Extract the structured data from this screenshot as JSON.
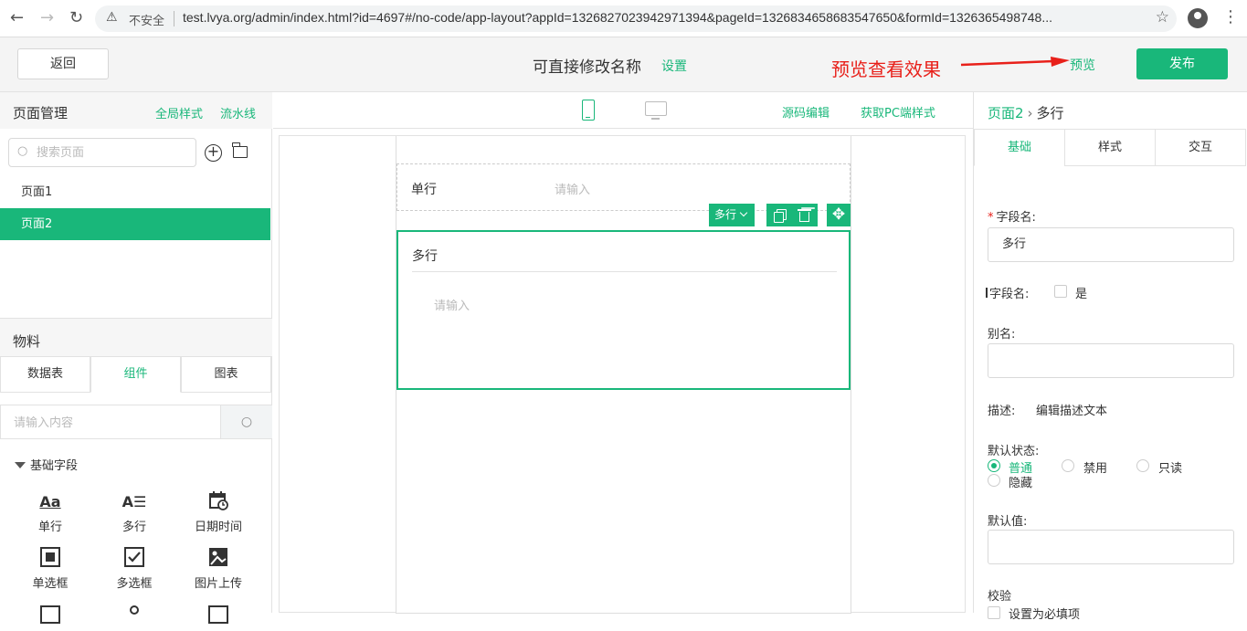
{
  "browser": {
    "insecure_label": "不安全",
    "url": "test.lvya.org/admin/index.html?id=4697#/no-code/app-layout?appId=1326827023942971394&pageId=1326834658683547650&formId=1326365498748..."
  },
  "toolbar": {
    "back_label": "返回",
    "app_name": "可直接修改名称",
    "settings_label": "设置",
    "annotation": "预览查看效果",
    "preview_label": "预览",
    "publish_label": "发布",
    "accent_color": "#19b77a",
    "annotation_color": "#e8201a"
  },
  "left": {
    "title": "页面管理",
    "global_style": "全局样式",
    "pipeline": "流水线",
    "search_placeholder": "搜索页面",
    "pages": [
      {
        "label": "页面1",
        "active": false
      },
      {
        "label": "页面2",
        "active": true
      }
    ],
    "materials_title": "物料",
    "tabs": [
      {
        "label": "数据表"
      },
      {
        "label": "组件",
        "active": true
      },
      {
        "label": "图表"
      }
    ],
    "material_search_placeholder": "请输入内容",
    "group_title": "基础字段",
    "components": [
      {
        "label": "单行",
        "icon": "Aa"
      },
      {
        "label": "多行",
        "icon": "A≡"
      },
      {
        "label": "日期时间",
        "icon": "calendar"
      },
      {
        "label": "单选框",
        "icon": "radio-square"
      },
      {
        "label": "多选框",
        "icon": "checkbox"
      },
      {
        "label": "图片上传",
        "icon": "image-upload"
      }
    ]
  },
  "center": {
    "source_edit": "源码编辑",
    "get_pc_style": "获取PC端样式",
    "single_field": {
      "label": "单行",
      "placeholder": "请输入"
    },
    "selected_type": "多行",
    "multi_field": {
      "label": "多行",
      "placeholder": "请输入"
    }
  },
  "right": {
    "crumb_page": "页面2",
    "crumb_field": "多行",
    "tabs": [
      {
        "label": "基础",
        "active": true
      },
      {
        "label": "样式"
      },
      {
        "label": "交互"
      }
    ],
    "field_name_label": "字段名:",
    "field_name_value": "多行",
    "hide_field_label": "字段名:",
    "hide_field_option": "是",
    "alias_label": "别名:",
    "desc_label": "描述:",
    "desc_link": "编辑描述文本",
    "default_state_label": "默认状态:",
    "states": [
      {
        "label": "普通",
        "selected": true
      },
      {
        "label": "禁用"
      },
      {
        "label": "只读"
      },
      {
        "label": "隐藏"
      }
    ],
    "default_value_label": "默认值:",
    "validation_label": "校验",
    "required_label": "设置为必填项"
  }
}
